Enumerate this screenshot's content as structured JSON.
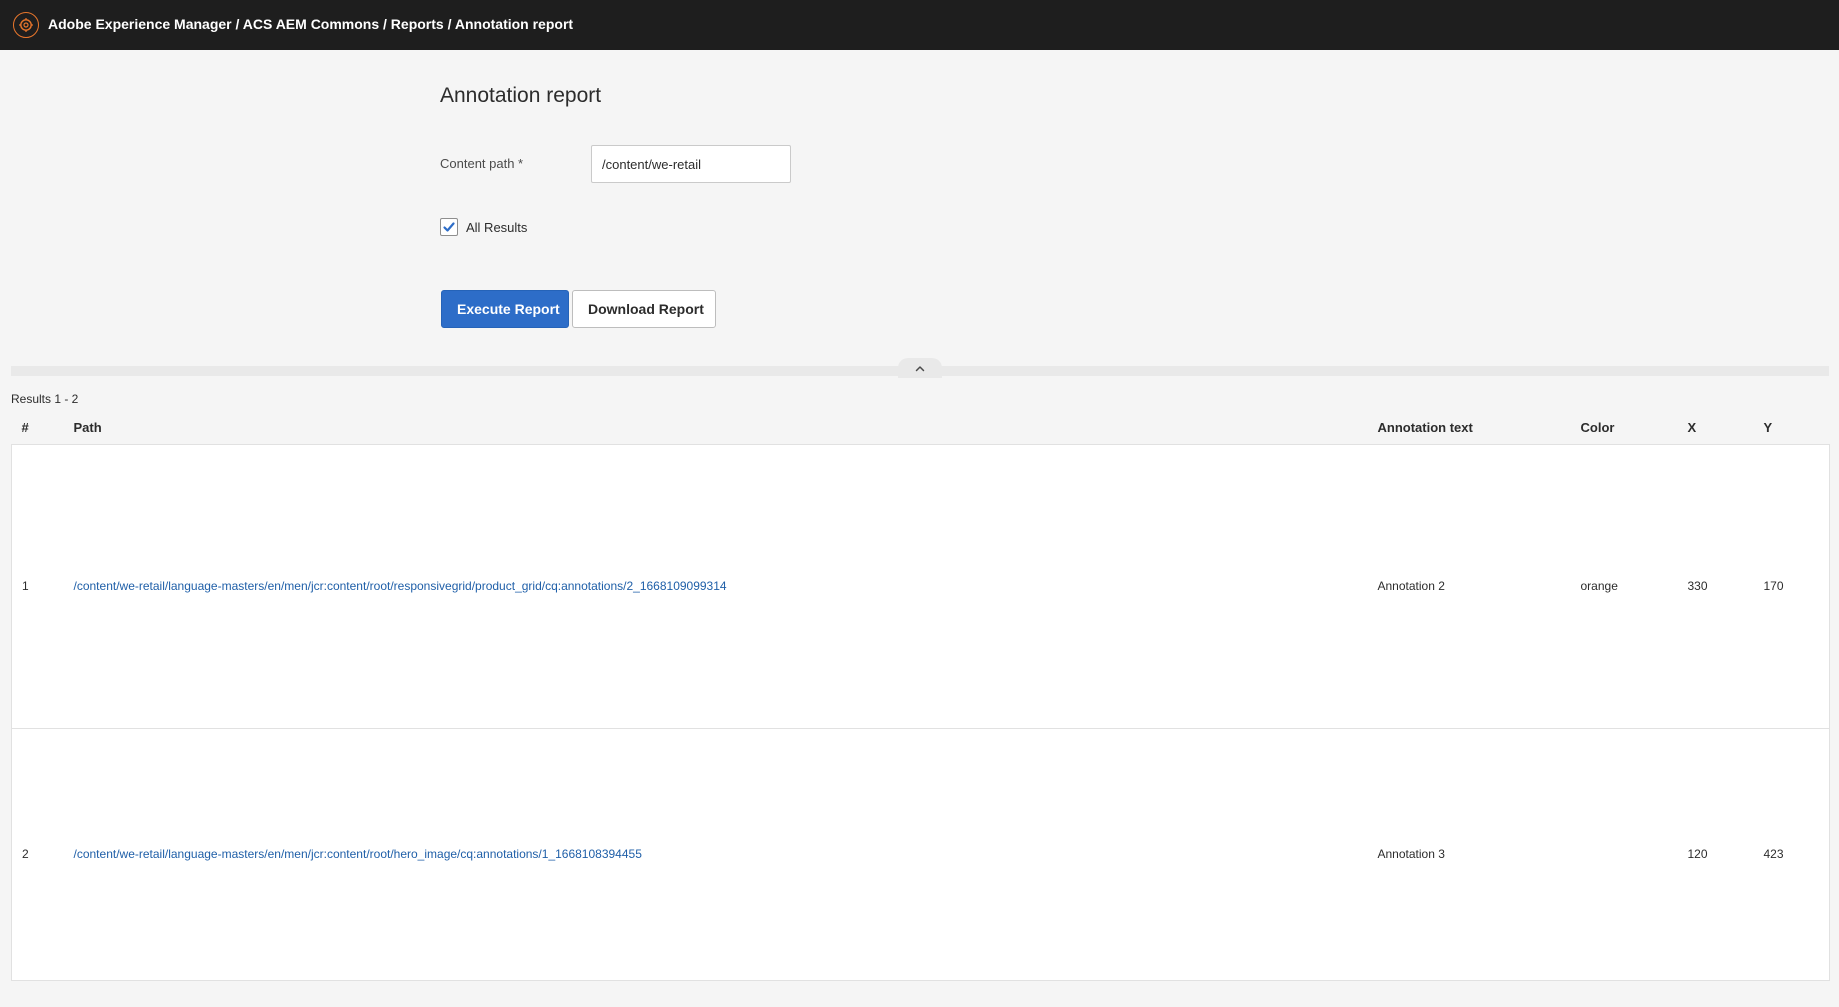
{
  "header": {
    "title": "Adobe Experience Manager / ACS AEM Commons / Reports / Annotation report",
    "logo_icon": "aem-logo-icon",
    "accent_color": "#e8762c"
  },
  "form": {
    "page_title": "Annotation report",
    "content_path_label": "Content path *",
    "content_path_value": "/content/we-retail",
    "all_results_label": "All Results",
    "all_results_checked": true,
    "execute_button": "Execute Report",
    "download_button": "Download Report",
    "primary_color": "#2d6dc8"
  },
  "results": {
    "count_label": "Results 1 - 2",
    "columns": [
      "#",
      "Path",
      "Annotation text",
      "Color",
      "X",
      "Y"
    ],
    "rows": [
      {
        "num": "1",
        "path": "/content/we-retail/language-masters/en/men/jcr:content/root/responsivegrid/product_grid/cq:annotations/2_1668109099314",
        "text": "Annotation 2",
        "color": "orange",
        "x": "330",
        "y": "170"
      },
      {
        "num": "2",
        "path": "/content/we-retail/language-masters/en/men/jcr:content/root/hero_image/cq:annotations/1_1668108394455",
        "text": "Annotation 3",
        "color": "",
        "x": "120",
        "y": "423"
      }
    ],
    "link_color": "#1f5fa8"
  }
}
